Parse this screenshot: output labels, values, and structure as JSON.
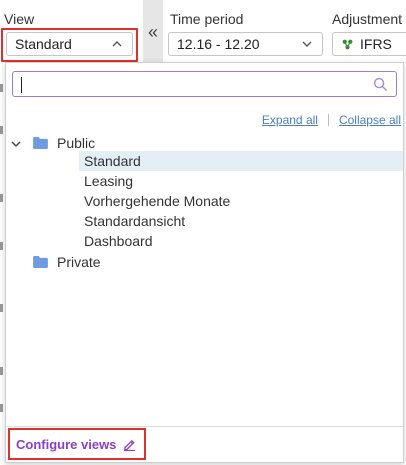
{
  "toolbar": {
    "view_label": "View",
    "view_value": "Standard",
    "period_label": "Time period",
    "period_value": "12.16 - 12.20",
    "adjustment_label": "Adjustment",
    "adjustment_value": "IFRS",
    "collapse_glyph": "«"
  },
  "dropdown": {
    "search_value": "",
    "expand_all": "Expand all",
    "collapse_all": "Collapse all",
    "folders": [
      {
        "label": "Public",
        "expanded": true,
        "items": [
          {
            "label": "Standard",
            "selected": true
          },
          {
            "label": "Leasing",
            "selected": false
          },
          {
            "label": "Vorhergehende Monate",
            "selected": false
          },
          {
            "label": "Standardansicht",
            "selected": false
          },
          {
            "label": "Dashboard",
            "selected": false
          }
        ]
      },
      {
        "label": "Private",
        "expanded": false,
        "items": []
      }
    ],
    "configure_views": "Configure views"
  },
  "colors": {
    "highlight": "#e0302c",
    "link": "#4a7fc1",
    "configure": "#8a3fc8",
    "folder": "#6f9be0",
    "selected_row": "#e3eff5",
    "adjustment_icon": "#3a8a3a"
  }
}
